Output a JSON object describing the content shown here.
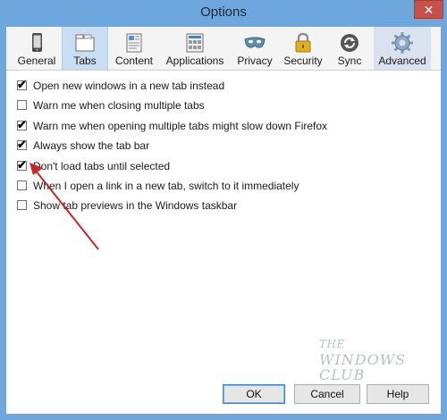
{
  "window": {
    "title": "Options",
    "close_glyph": "✕"
  },
  "toolbar": {
    "tabs": [
      {
        "label": "General",
        "icon": "phone-icon"
      },
      {
        "label": "Tabs",
        "icon": "folder-tabs-icon",
        "selected": true
      },
      {
        "label": "Content",
        "icon": "content-document-icon"
      },
      {
        "label": "Applications",
        "icon": "applications-grid-icon"
      },
      {
        "label": "Privacy",
        "icon": "mask-icon"
      },
      {
        "label": "Security",
        "icon": "padlock-icon"
      },
      {
        "label": "Sync",
        "icon": "sync-arrows-icon"
      },
      {
        "label": "Advanced",
        "icon": "gear-icon"
      }
    ]
  },
  "options": [
    {
      "label": "Open new windows in a new tab instead",
      "checked": true
    },
    {
      "label": "Warn me when closing multiple tabs",
      "checked": false
    },
    {
      "label": "Warn me when opening multiple tabs might slow down Firefox",
      "checked": true
    },
    {
      "label": "Always show the tab bar",
      "checked": true
    },
    {
      "label": "Don't load tabs until selected",
      "checked": true
    },
    {
      "label": "When I open a link in a new tab, switch to it immediately",
      "checked": false
    },
    {
      "label": "Show tab previews in the Windows taskbar",
      "checked": false
    }
  ],
  "watermark": {
    "line1": "THE",
    "line2": "WINDOWS CLUB"
  },
  "buttons": {
    "ok": "OK",
    "cancel": "Cancel",
    "help": "Help"
  },
  "colors": {
    "titlebar": "#6ea7de",
    "selected_tab": "#c9ddf3",
    "close": "#c7504a",
    "arrow": "#c62828"
  }
}
